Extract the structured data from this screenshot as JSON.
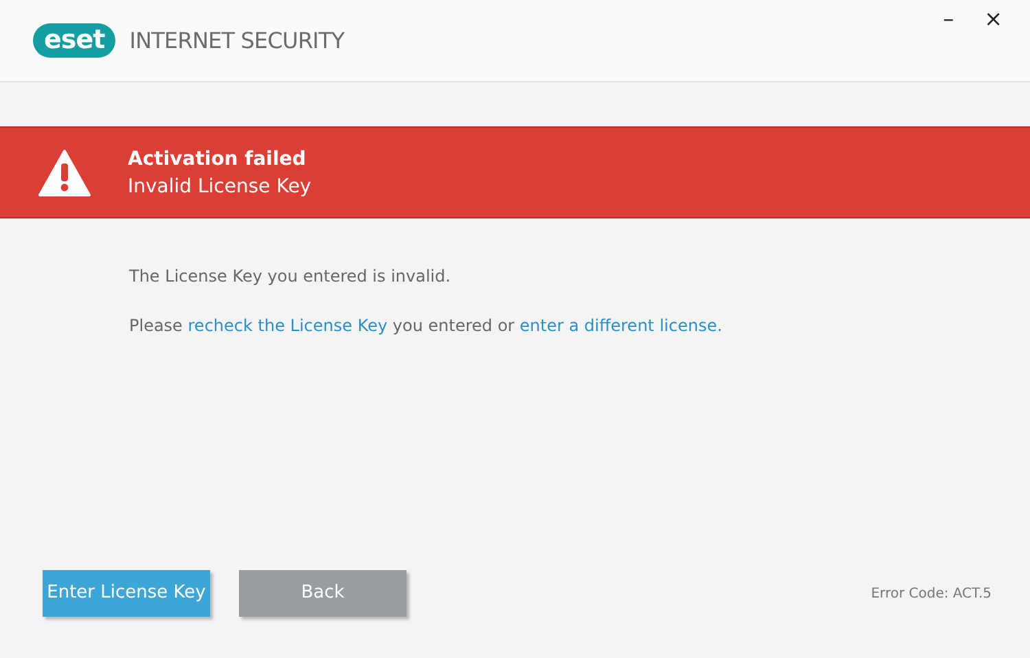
{
  "header": {
    "logo": "eset",
    "product": "INTERNET SECURITY"
  },
  "window_controls": [
    "–",
    "×"
  ],
  "alert": {
    "title": "Activation failed",
    "subtitle": "Invalid License Key"
  },
  "message": "The License Key you entered is invalid.",
  "hint": [
    {
      "kind": "text",
      "text": "Please "
    },
    {
      "kind": "link",
      "text": "recheck the License Key"
    },
    {
      "kind": "text",
      "text": " you entered or "
    },
    {
      "kind": "link",
      "text": "enter a different license."
    }
  ],
  "buttons": [
    {
      "label": "Enter License Key",
      "kind": "primary"
    },
    {
      "label": "Back",
      "kind": "secondary"
    }
  ],
  "error_code": "Error Code: ACT.5"
}
